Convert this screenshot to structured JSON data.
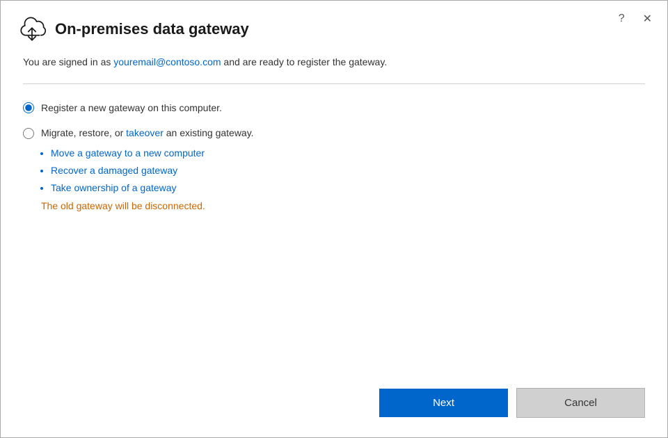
{
  "dialog": {
    "title": "On-premises data gateway",
    "help_label": "?",
    "close_label": "✕"
  },
  "signed_in": {
    "prefix": "You are signed in as ",
    "email": "youremail@contoso.com",
    "suffix": " and are ready to register the gateway."
  },
  "options": {
    "option1": {
      "label": "Register a new gateway on this computer."
    },
    "option2": {
      "prefix": "Migrate, restore, or ",
      "link_text": "takeover",
      "suffix": " an existing gateway.",
      "bullets": [
        "Move a gateway to a new computer",
        "Recover a damaged gateway",
        "Take ownership of a gateway"
      ],
      "note": "The old gateway will be disconnected."
    }
  },
  "footer": {
    "next_label": "Next",
    "cancel_label": "Cancel"
  }
}
